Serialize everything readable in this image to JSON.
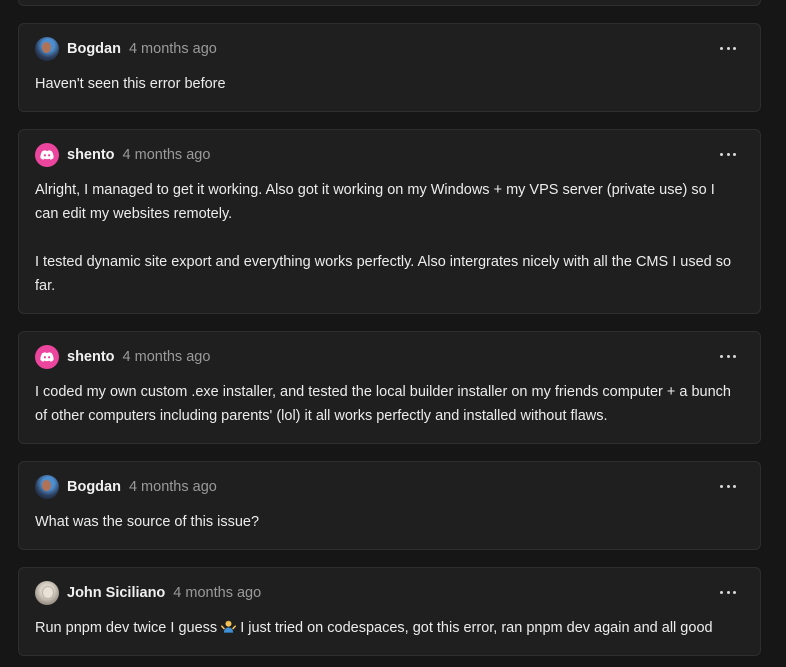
{
  "comments": [
    {
      "author": "Bogdan",
      "time": "4 months ago",
      "avatar": "bogdan-avatar",
      "body": "Haven't seen this error before"
    },
    {
      "author": "shento",
      "time": "4 months ago",
      "avatar": "discord-avatar",
      "body_p1": "Alright, I managed to get it working. Also got it working on my Windows + my VPS server (private use) so I can edit my websites remotely.",
      "body_p2": "I tested dynamic site export and everything works perfectly. Also intergrates nicely with all the CMS I used so far."
    },
    {
      "author": "shento",
      "time": "4 months ago",
      "avatar": "discord-avatar",
      "body": "I coded my own custom .exe installer, and tested the local builder installer on my friends computer + a bunch of other computers including parents' (lol) it all works perfectly and installed without flaws."
    },
    {
      "author": "Bogdan",
      "time": "4 months ago",
      "avatar": "bogdan-avatar",
      "body": "What was the source of this issue?"
    },
    {
      "author": "John Siciliano",
      "time": "4 months ago",
      "avatar": "john-avatar",
      "body_before_emoji": "Run pnpm dev twice I guess",
      "emoji": "person-shrugging-emoji",
      "body_after_emoji": "I just tried on codespaces, got this error, ran pnpm dev again and all good"
    }
  ],
  "colors": {
    "background": "#161616",
    "card": "#1f1f1f",
    "border": "#2e2e2e",
    "discord": "#eb459e",
    "muted": "#9a9a9a"
  }
}
